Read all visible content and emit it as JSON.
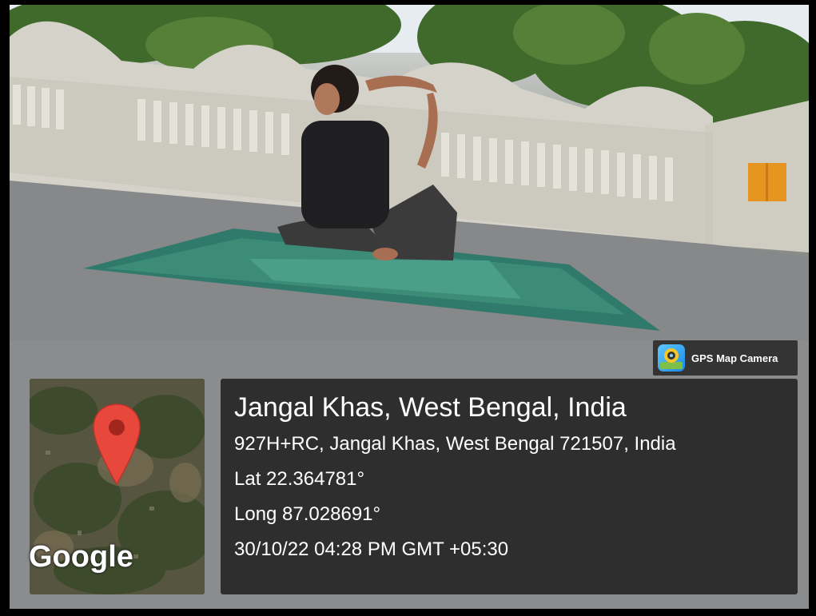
{
  "badge": {
    "icon": "gps-map-camera-app-icon",
    "label": "GPS Map Camera"
  },
  "map": {
    "logo_text": "Google",
    "pin_icon": "map-pin-icon",
    "pin_color": "#e8473c"
  },
  "location": {
    "title": "Jangal Khas, West Bengal, India",
    "address": "927H+RC, Jangal Khas, West Bengal 721507, India",
    "latitude": "Lat 22.364781°",
    "longitude": "Long 87.028691°",
    "datetime": "30/10/22 04:28 PM GMT +05:30"
  }
}
